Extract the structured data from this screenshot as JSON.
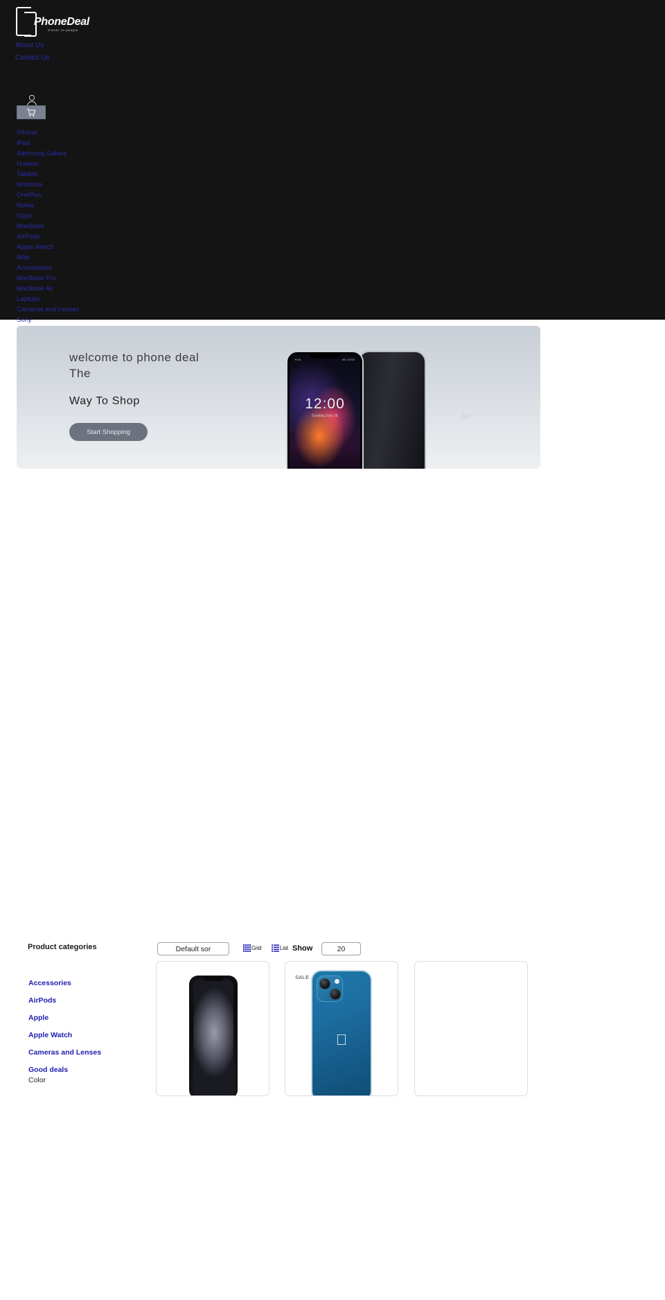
{
  "brand": {
    "name": "PhoneDeal",
    "tagline": "Closer to people",
    "logo_icon": "phone-outline-logo-icon"
  },
  "header": {
    "background": "#141414",
    "link_color": "#2b2ba8",
    "top_links": [
      {
        "label": "About Us"
      },
      {
        "label": "Contact Us"
      }
    ],
    "account_icon": "user-account-icon",
    "cart_icon": "shopping-cart-icon",
    "cart_button_color": "#7b8190",
    "nav_items": [
      {
        "label": "iPhone"
      },
      {
        "label": "iPad"
      },
      {
        "label": "Samsung Galaxy"
      },
      {
        "label": "Huawei"
      },
      {
        "label": "Tablets"
      },
      {
        "label": "Motorola"
      },
      {
        "label": "OnePlus"
      },
      {
        "label": "Nokia"
      },
      {
        "label": "Oppo"
      },
      {
        "label": "MacBook"
      },
      {
        "label": "AirPods"
      },
      {
        "label": "Apple Watch"
      },
      {
        "label": "iMac"
      },
      {
        "label": "Accessories"
      },
      {
        "label": "MacBook Pro"
      },
      {
        "label": "MacBook Air"
      },
      {
        "label": "Laptops"
      },
      {
        "label": "Cameras and Lenses"
      },
      {
        "label": "Sony"
      }
    ]
  },
  "hero": {
    "title_line1": "welcome to phone deal",
    "title_line2": "The",
    "subtitle": "Way To Shop",
    "cta_label": "Start Shopping",
    "cta_color": "#6c727e",
    "phone_status_left": "9:41",
    "phone_status_right": "4G 12:00",
    "phone_time": "12:00",
    "phone_date": "Sunday,July 18",
    "phone_brand_mark": "MI"
  },
  "shop": {
    "categories_heading": "Product categories",
    "sort_value": "Default sor",
    "view_grid_label": "Grid",
    "view_grid_icon": "grid-view-icon",
    "view_list_label": "List",
    "view_list_icon": "list-view-icon",
    "show_label": "Show",
    "show_value": "20",
    "category_links": [
      {
        "label": "Accessories"
      },
      {
        "label": "AirPods"
      },
      {
        "label": "Apple"
      },
      {
        "label": "Apple Watch"
      },
      {
        "label": "Cameras and Lenses"
      },
      {
        "label": "Good deals"
      }
    ],
    "color_heading": "Color",
    "category_link_color": "#2020b0",
    "products": [
      {
        "badge": "",
        "image_alt": "black iphone front"
      },
      {
        "badge": "SALE",
        "image_alt": "blue iphone 13 back"
      },
      {
        "badge": "",
        "image_alt": "empty product card"
      }
    ]
  }
}
